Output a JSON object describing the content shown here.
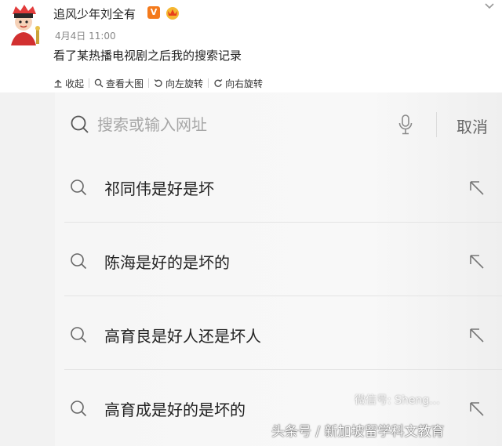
{
  "post": {
    "username": "追风少年刘全有",
    "vip_badge": "V",
    "time": "4月4日 11:00",
    "text": "看了某热播电视剧之后我的搜索记录"
  },
  "toolbar": {
    "collapse_label": "收起",
    "view_large_label": "查看大图",
    "rotate_left_label": "向左旋转",
    "rotate_right_label": "向右旋转"
  },
  "search": {
    "placeholder": "搜索或输入网址",
    "cancel_label": "取消"
  },
  "history": [
    {
      "text": "祁同伟是好是坏"
    },
    {
      "text": "陈海是好的是坏的"
    },
    {
      "text": "高育良是好人还是坏人"
    },
    {
      "text": "高育成是好的是坏的"
    }
  ],
  "watermark": {
    "text": "头条号 / 新加坡留学科文教育",
    "faint_text": "微信号: Sheng..."
  },
  "colors": {
    "vip": "#f47a1c",
    "text": "#222222",
    "muted": "#888888"
  }
}
